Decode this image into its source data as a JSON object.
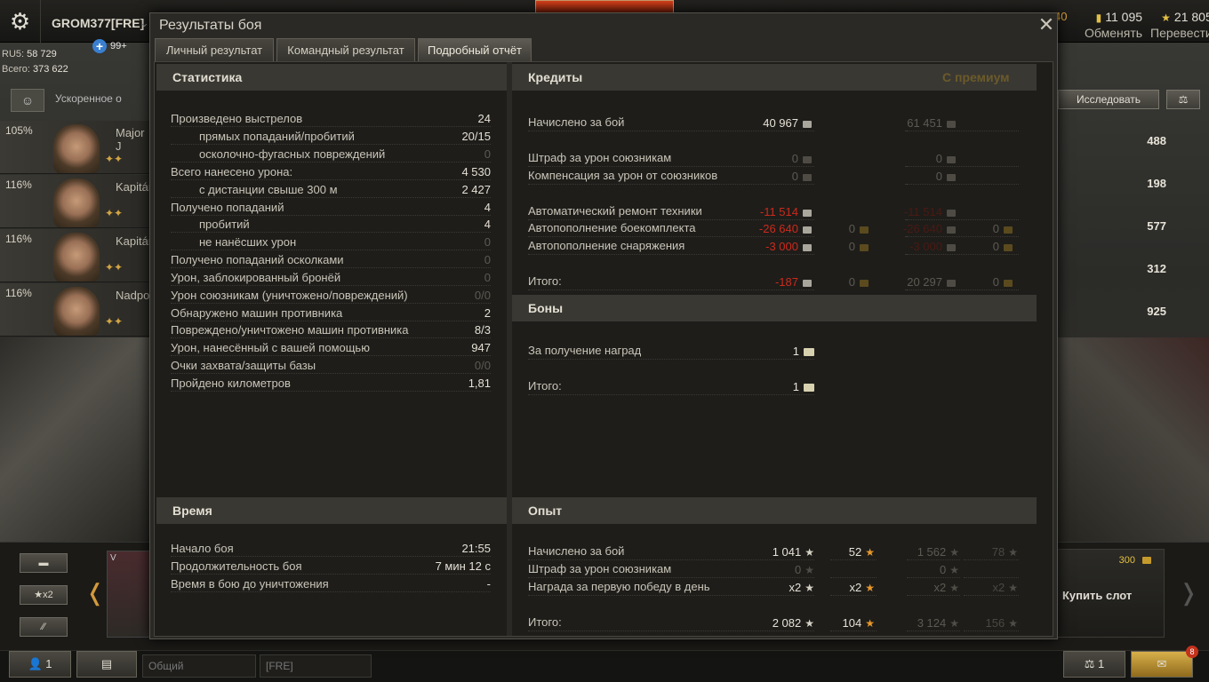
{
  "topbar": {
    "player_name": "GROM377[FRE]",
    "plus_count": "99+",
    "server_label": "RU5:",
    "server_value": "58 729",
    "total_label": "Всего:",
    "total_value": "373 622",
    "yellow_value": "40",
    "gold_value": "11 095",
    "gold_label": "Обменять",
    "free_value": "21 805",
    "free_label": "Перевести"
  },
  "garage": {
    "accel_label": "Ускоренное о",
    "research_label": "Исследовать",
    "crew": [
      {
        "pct": "105%",
        "rank": "Major J"
      },
      {
        "pct": "116%",
        "rank": "Kapitán"
      },
      {
        "pct": "116%",
        "rank": "Kapitán"
      },
      {
        "pct": "116%",
        "rank": "Nadpo"
      }
    ],
    "right_stats": [
      "488",
      "198",
      "577",
      "312",
      "925"
    ],
    "filter_xp": "x2",
    "tank_tier": "V",
    "slot_price": "300",
    "slot_label": "Купить слот",
    "bottom_btn_1": "1",
    "channel_1": "Общий",
    "channel_2": "[FRE]",
    "bottom_btn_3": "1",
    "notif_count": "8"
  },
  "dialog": {
    "title": "Результаты боя",
    "tabs": [
      "Личный результат",
      "Командный результат",
      "Подробный отчёт"
    ],
    "active_tab": 2
  },
  "stats": {
    "header": "Статистика",
    "rows": [
      {
        "label": "Произведено выстрелов",
        "value": "24",
        "indent": false,
        "dim": false
      },
      {
        "label": "прямых попаданий/пробитий",
        "value": "20/15",
        "indent": true,
        "dim": false
      },
      {
        "label": "осколочно-фугасных повреждений",
        "value": "0",
        "indent": true,
        "dim": true
      },
      {
        "label": "Всего нанесено урона:",
        "value": "4 530",
        "indent": false,
        "dim": false
      },
      {
        "label": "с дистанции свыше 300 м",
        "value": "2 427",
        "indent": true,
        "dim": false
      },
      {
        "label": "Получено попаданий",
        "value": "4",
        "indent": false,
        "dim": false
      },
      {
        "label": "пробитий",
        "value": "4",
        "indent": true,
        "dim": false
      },
      {
        "label": "не нанёсших урон",
        "value": "0",
        "indent": true,
        "dim": true
      },
      {
        "label": "Получено попаданий осколками",
        "value": "0",
        "indent": false,
        "dim": true
      },
      {
        "label": "Урон, заблокированный бронёй",
        "value": "0",
        "indent": false,
        "dim": true
      },
      {
        "label": "Урон союзникам (уничтожено/повреждений)",
        "value": "0/0",
        "indent": false,
        "dim": true
      },
      {
        "label": "Обнаружено машин противника",
        "value": "2",
        "indent": false,
        "dim": false
      },
      {
        "label": "Повреждено/уничтожено машин противника",
        "value": "8/3",
        "indent": false,
        "dim": false
      },
      {
        "label": "Урон, нанесённый с вашей помощью",
        "value": "947",
        "indent": false,
        "dim": false
      },
      {
        "label": "Очки захвата/защиты базы",
        "value": "0/0",
        "indent": false,
        "dim": true
      },
      {
        "label": "Пройдено километров",
        "value": "1,81",
        "indent": false,
        "dim": false
      }
    ]
  },
  "time": {
    "header": "Время",
    "rows": [
      {
        "label": "Начало боя",
        "value": "21:55"
      },
      {
        "label": "Продолжительность боя",
        "value": "7 мин 12 с"
      },
      {
        "label": "Время в бою до уничтожения",
        "value": "-"
      }
    ]
  },
  "credits": {
    "header": "Кредиты",
    "premium_header": "С премиум",
    "rows": [
      {
        "label": "Начислено за бой",
        "c1": "40 967",
        "c2": "",
        "c3": "61 451",
        "c4": "",
        "c1cls": "wht",
        "c3cls": "dim",
        "gold": false
      },
      {
        "label": "Штраф за урон союзникам",
        "c1": "0",
        "c2": "",
        "c3": "0",
        "c4": "",
        "c1cls": "dim",
        "c3cls": "dim",
        "gold": false
      },
      {
        "label": "Компенсация за урон от союзников",
        "c1": "0",
        "c2": "",
        "c3": "0",
        "c4": "",
        "c1cls": "dim",
        "c3cls": "dim",
        "gold": false
      },
      {
        "label": "Автоматический ремонт техники",
        "c1": "-11 514",
        "c2": "",
        "c3": "-11 514",
        "c4": "",
        "c1cls": "red",
        "c3cls": "dimred",
        "gold": false
      },
      {
        "label": "Автопополнение боекомплекта",
        "c1": "-26 640",
        "c2": "0",
        "c3": "-26 640",
        "c4": "0",
        "c1cls": "red",
        "c3cls": "dimred",
        "gold": true
      },
      {
        "label": "Автопополнение снаряжения",
        "c1": "-3 000",
        "c2": "0",
        "c3": "-3 000",
        "c4": "0",
        "c1cls": "red",
        "c3cls": "dimred",
        "gold": true
      },
      {
        "label": "Итого:",
        "c1": "-187",
        "c2": "0",
        "c3": "20 297",
        "c4": "0",
        "c1cls": "red",
        "c3cls": "dim",
        "gold": true
      }
    ]
  },
  "bonds": {
    "header": "Боны",
    "rows": [
      {
        "label": "За получение наград",
        "value": "1"
      },
      {
        "label": "Итого:",
        "value": "1"
      }
    ]
  },
  "xp": {
    "header": "Опыт",
    "rows": [
      {
        "label": "Начислено за бой",
        "c1": "1 041",
        "c2": "52",
        "c3": "1 562",
        "c4": "78",
        "c1cls": "wht",
        "c2show": true
      },
      {
        "label": "Штраф за урон союзникам",
        "c1": "0",
        "c2": "",
        "c3": "0",
        "c4": "",
        "c1cls": "dim",
        "c2show": false
      },
      {
        "label": "Награда за первую победу в день",
        "c1": "x2",
        "c2": "x2",
        "c3": "x2",
        "c4": "x2",
        "c1cls": "wht",
        "c2show": true
      },
      {
        "label": "Итого:",
        "c1": "2 082",
        "c2": "104",
        "c3": "3 124",
        "c4": "156",
        "c1cls": "wht",
        "c2show": true
      }
    ]
  },
  "icons": {
    "credit": "credit-coin-icon",
    "gold": "gold-coin-icon",
    "bond": "bond-icon",
    "xp": "xp-star-icon",
    "free_xp": "free-xp-star-icon"
  },
  "colors": {
    "accent_orange": "#e8982a",
    "negative_red": "#cc2a1c",
    "panel_bg": "#1e1d1a",
    "header_bg": "#393833"
  }
}
